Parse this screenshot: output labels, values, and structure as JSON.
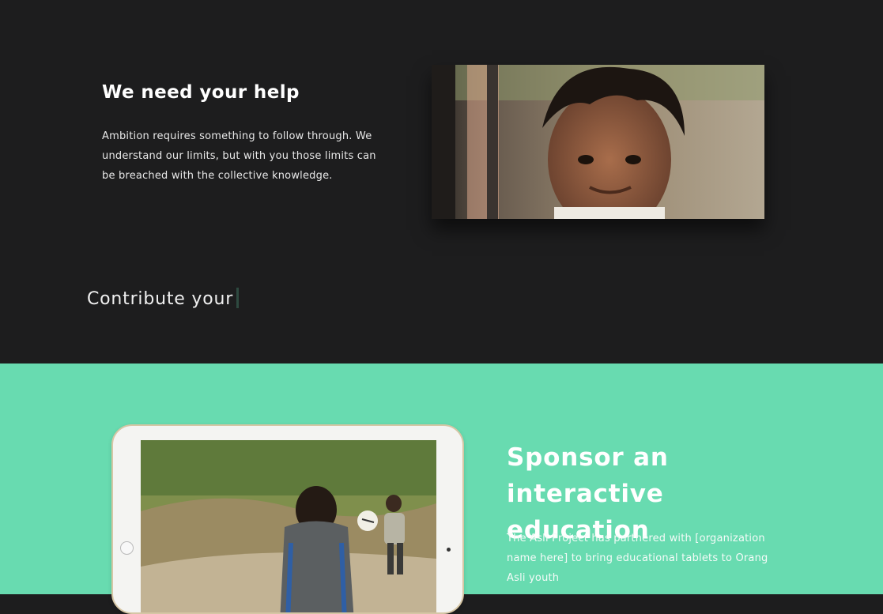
{
  "help": {
    "title": "We need your help",
    "body": "Ambition requires something to follow through. We understand our limits, but with you those limits can be breached with the collective knowledge."
  },
  "contribute": {
    "text": "Contribute your"
  },
  "sponsor": {
    "title": "Sponsor an interactive education",
    "body": "The Asli Project has partnered with [organization name here] to bring educational tablets to Orang Asli youth"
  },
  "colors": {
    "dark_bg": "#1d1d1e",
    "accent_green": "#68dbb0"
  }
}
